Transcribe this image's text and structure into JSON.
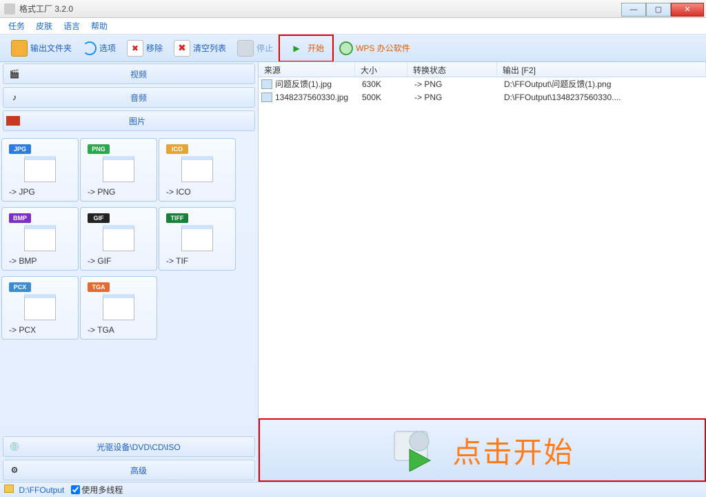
{
  "window": {
    "title": "格式工厂 3.2.0"
  },
  "menu": {
    "task": "任务",
    "skin": "皮肤",
    "language": "语言",
    "help": "帮助"
  },
  "toolbar": {
    "output_folder": "输出文件夹",
    "options": "选项",
    "remove": "移除",
    "clear_list": "清空列表",
    "stop": "停止",
    "start": "开始",
    "wps": "WPS 办公软件"
  },
  "categories": {
    "video": "视频",
    "audio": "音频",
    "image": "图片",
    "disc": "光驱设备\\DVD\\CD\\ISO",
    "advanced": "高级"
  },
  "formats": [
    {
      "badge": "JPG",
      "color": "#2b7ee0",
      "label": "-> JPG"
    },
    {
      "badge": "PNG",
      "color": "#2aa84a",
      "label": "-> PNG"
    },
    {
      "badge": "ICO",
      "color": "#e8a23a",
      "label": "-> ICO"
    },
    {
      "badge": "BMP",
      "color": "#7d2ec7",
      "label": "-> BMP"
    },
    {
      "badge": "GIF",
      "color": "#222222",
      "label": "-> GIF"
    },
    {
      "badge": "TIFF",
      "color": "#19803a",
      "label": "-> TIF"
    },
    {
      "badge": "PCX",
      "color": "#3d8bd4",
      "label": "-> PCX"
    },
    {
      "badge": "TGA",
      "color": "#e46a2e",
      "label": "-> TGA"
    }
  ],
  "list": {
    "headers": {
      "source": "来源",
      "size": "大小",
      "state": "转换状态",
      "output": "输出 [F2]"
    },
    "rows": [
      {
        "source": "问题反馈(1).jpg",
        "size": "630K",
        "state": "-> PNG",
        "output": "D:\\FFOutput\\问题反馈(1).png"
      },
      {
        "source": "1348237560330.jpg",
        "size": "500K",
        "state": "-> PNG",
        "output": "D:\\FFOutput\\1348237560330...."
      }
    ]
  },
  "banner": {
    "text": "点击开始"
  },
  "status": {
    "path": "D:\\FFOutput",
    "multithread": "使用多线程",
    "checked": true
  }
}
